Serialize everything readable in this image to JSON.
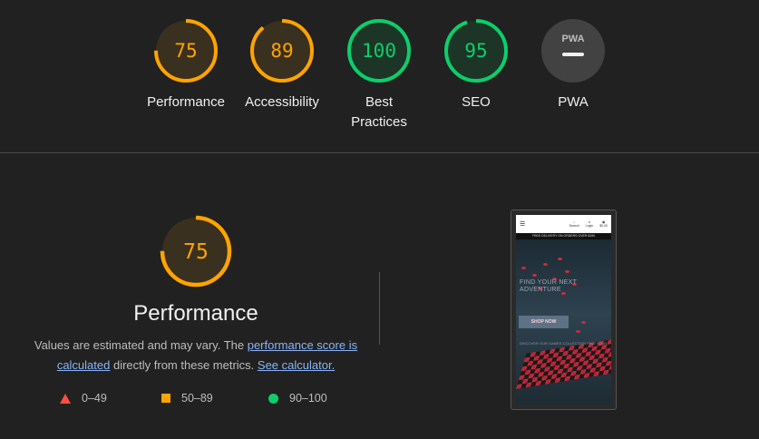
{
  "colors": {
    "pass": "#0cce6b",
    "average": "#ffa400",
    "fail": "#ff4e42",
    "na": "#9e9e9e",
    "link": "#8ab4f8"
  },
  "categories": [
    {
      "name": "Performance",
      "score": 75,
      "status": "average"
    },
    {
      "name": "Accessibility",
      "score": 89,
      "status": "average"
    },
    {
      "name": "Best Practices",
      "score": 100,
      "status": "pass"
    },
    {
      "name": "SEO",
      "score": 95,
      "status": "pass"
    },
    {
      "name": "PWA",
      "score": null,
      "status": "na",
      "badge": "PWA",
      "badge_icon": "pwa-dash-icon"
    }
  ],
  "performance_section": {
    "score": 75,
    "title": "Performance",
    "desc_prefix": "Values are estimated and may vary. The ",
    "desc_link1": "performance score is calculated",
    "desc_middle": " directly from these metrics. ",
    "desc_link2": "See calculator."
  },
  "legend": [
    {
      "range": "0–49",
      "icon": "triangle-icon"
    },
    {
      "range": "50–89",
      "icon": "square-icon"
    },
    {
      "range": "90–100",
      "icon": "circle-icon"
    }
  ],
  "screenshot": {
    "promo_text": "FREE DELIVERY ON ORDERS OVER $150",
    "nav_items": [
      "Search",
      "Login",
      "$0.00"
    ],
    "headline": "FIND YOUR NEXT ADVENTURE",
    "cta_label": "SHOP NOW",
    "subtext": "DISCOVER OUR GAMES COLLECTION FIND YOUR"
  }
}
